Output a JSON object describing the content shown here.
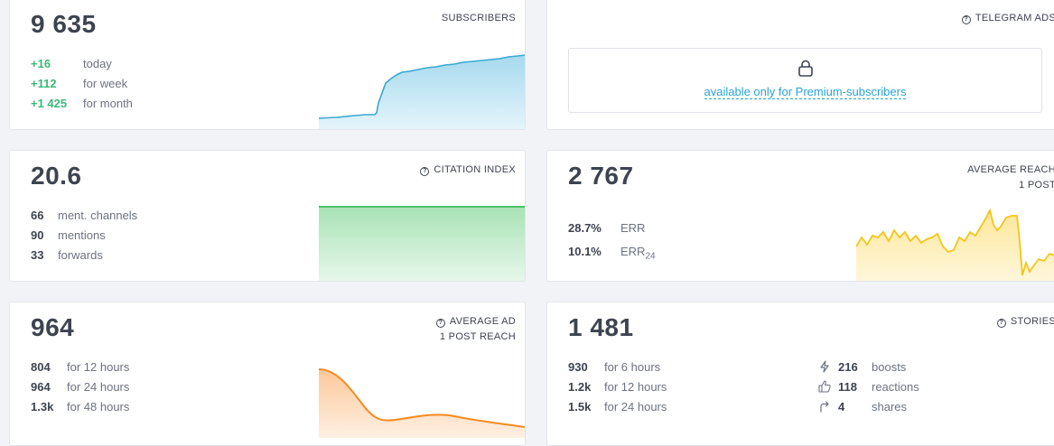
{
  "subscribers": {
    "value": "9 635",
    "label": "SUBSCRIBERS",
    "rows": [
      {
        "value": "+16",
        "text": "today"
      },
      {
        "value": "+112",
        "text": "for week"
      },
      {
        "value": "+1 425",
        "text": "for month"
      }
    ],
    "color": "#3aa8d2"
  },
  "telegram_ads": {
    "label": "TELEGRAM ADS",
    "link": "available only for Premium-subscribers",
    "icon": "lock-icon"
  },
  "citation": {
    "value": "20.6",
    "label": "CITATION INDEX",
    "rows": [
      {
        "value": "66",
        "text": "ment. channels"
      },
      {
        "value": "90",
        "text": "mentions"
      },
      {
        "value": "33",
        "text": "forwards"
      }
    ],
    "color": "#4cc36a"
  },
  "reach": {
    "value": "2 767",
    "label_line1": "AVERAGE REACH",
    "label_line2": "1 POST",
    "err_value": "28.7%",
    "err_text": "ERR",
    "err24_value": "10.1%",
    "err24_text": "ERR",
    "err24_sub": "24",
    "color": "#f5c518"
  },
  "ad_reach": {
    "value": "964",
    "label_line1": "AVERAGE AD",
    "label_line2": "1 POST REACH",
    "rows": [
      {
        "value": "804",
        "text": "for 12 hours"
      },
      {
        "value": "964",
        "text": "for 24 hours"
      },
      {
        "value": "1.3k",
        "text": "for 48 hours"
      }
    ],
    "color": "#f58a1f"
  },
  "stories": {
    "value": "1 481",
    "label": "STORIES",
    "rows": [
      {
        "value": "930",
        "text": "for 6 hours"
      },
      {
        "value": "1.2k",
        "text": "for 12 hours"
      },
      {
        "value": "1.5k",
        "text": "for 24 hours"
      }
    ],
    "stats": [
      {
        "icon": "lightning-icon",
        "value": "216",
        "text": "boosts"
      },
      {
        "icon": "thumbs-up-icon",
        "value": "118",
        "text": "reactions"
      },
      {
        "icon": "share-arrow-icon",
        "value": "4",
        "text": "shares"
      }
    ]
  }
}
